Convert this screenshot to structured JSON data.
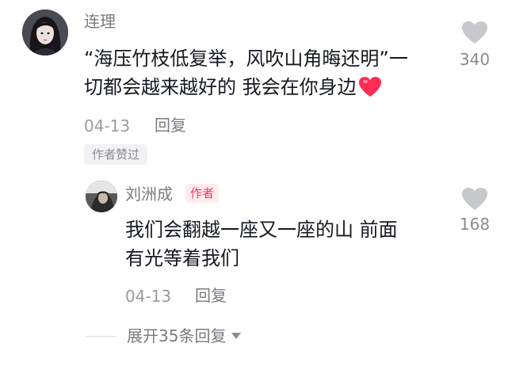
{
  "comment": {
    "username": "连理",
    "lines": [
      "“海压竹枝低复举，风吹山角晦还明”一",
      "切都会越来越好的 我会在你身边"
    ],
    "date": "04-13",
    "reply_label": "回复",
    "likes": "340",
    "liked_by_author_label": "作者赞过"
  },
  "reply": {
    "username": "刘洲成",
    "author_badge": "作者",
    "lines": [
      "我们会翻越一座又一座的山 前面",
      "有光等着我们"
    ],
    "date": "04-13",
    "reply_label": "回复",
    "likes": "168"
  },
  "expand": {
    "label": "展开35条回复"
  },
  "colors": {
    "accent": "#f73a5e",
    "heart_emoji": "#fe2c55",
    "like_icon": "#c7c8cc"
  }
}
